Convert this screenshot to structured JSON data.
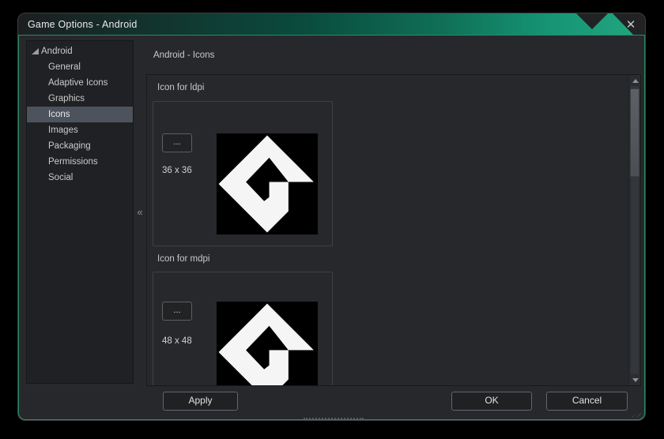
{
  "window": {
    "title": "Game Options - Android",
    "close_glyph": "✕"
  },
  "sidebar": {
    "root": {
      "label": "Android",
      "expanded": true
    },
    "items": [
      {
        "label": "General",
        "selected": false
      },
      {
        "label": "Adaptive Icons",
        "selected": false
      },
      {
        "label": "Graphics",
        "selected": false
      },
      {
        "label": "Icons",
        "selected": true
      },
      {
        "label": "Images",
        "selected": false
      },
      {
        "label": "Packaging",
        "selected": false
      },
      {
        "label": "Permissions",
        "selected": false
      },
      {
        "label": "Social",
        "selected": false
      }
    ],
    "collapse_glyph": "«"
  },
  "main": {
    "header": "Android - Icons",
    "sections": [
      {
        "label": "Icon for ldpi",
        "browse_label": "...",
        "size": "36 x 36",
        "icon": "gamemaker-logo"
      },
      {
        "label": "Icon for mdpi",
        "browse_label": "...",
        "size": "48 x 48",
        "icon": "gamemaker-logo"
      }
    ]
  },
  "footer": {
    "apply_label": "Apply",
    "ok_label": "OK",
    "cancel_label": "Cancel"
  },
  "colors": {
    "accent_teal": "#1fa37d",
    "body_border_green": "#2c8a67",
    "window_bg": "#26282b",
    "sidebar_bg": "#1f2124",
    "selected_item_bg": "#4d535c",
    "icon_bg": "#000000",
    "icon_fg": "#f5f5f5"
  }
}
